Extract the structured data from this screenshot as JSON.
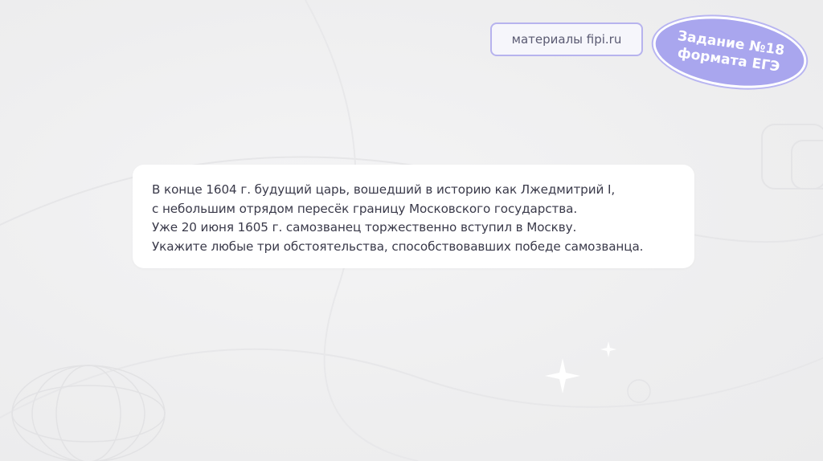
{
  "source_badge": {
    "label": "материалы fipi.ru"
  },
  "task_badge": {
    "line1": "Задание №18",
    "line2": "формата ЕГЭ"
  },
  "task_text": {
    "lines": [
      "В конце 1604 г. будущий царь, вошедший в историю как Лжедмитрий I,",
      "с небольшим отрядом пересёк границу Московского государства.",
      "Уже 20 июня 1605 г. самозванец торжественно вступил в Москву.",
      "Укажите любые три обстоятельства, способствовавших победе самозванца."
    ]
  },
  "colors": {
    "badge_fill": "#a9a6ee",
    "badge_border": "#b7b3ee",
    "background": "#efeff0",
    "card": "#ffffff",
    "text": "#3a3a4a"
  }
}
